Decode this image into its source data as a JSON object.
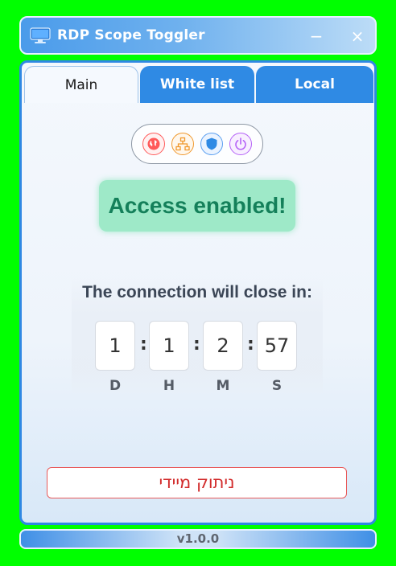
{
  "window": {
    "title": "RDP Scope Toggler",
    "minimize": "−",
    "close": "×"
  },
  "tabs": [
    {
      "label": "Main",
      "active": true
    },
    {
      "label": "White list",
      "active": false
    },
    {
      "label": "Local",
      "active": false
    }
  ],
  "scope_buttons": [
    {
      "name": "globe-icon",
      "color": "#ff5a5a"
    },
    {
      "name": "network-icon",
      "color": "#f0982c"
    },
    {
      "name": "shield-icon",
      "color": "#2f8ae4"
    },
    {
      "name": "power-icon",
      "color": "#b562f7"
    }
  ],
  "status": {
    "text": "Access enabled!",
    "color": "#14805a"
  },
  "countdown": {
    "label": "The connection will close in:",
    "days": "1",
    "hours": "1",
    "minutes": "2",
    "seconds": "57",
    "separator": ":",
    "unit_days": "D",
    "unit_hours": "H",
    "unit_minutes": "M",
    "unit_seconds": "S"
  },
  "disconnect_button": "ניתוק מיידי",
  "footer": {
    "version": "v1.0.0"
  }
}
